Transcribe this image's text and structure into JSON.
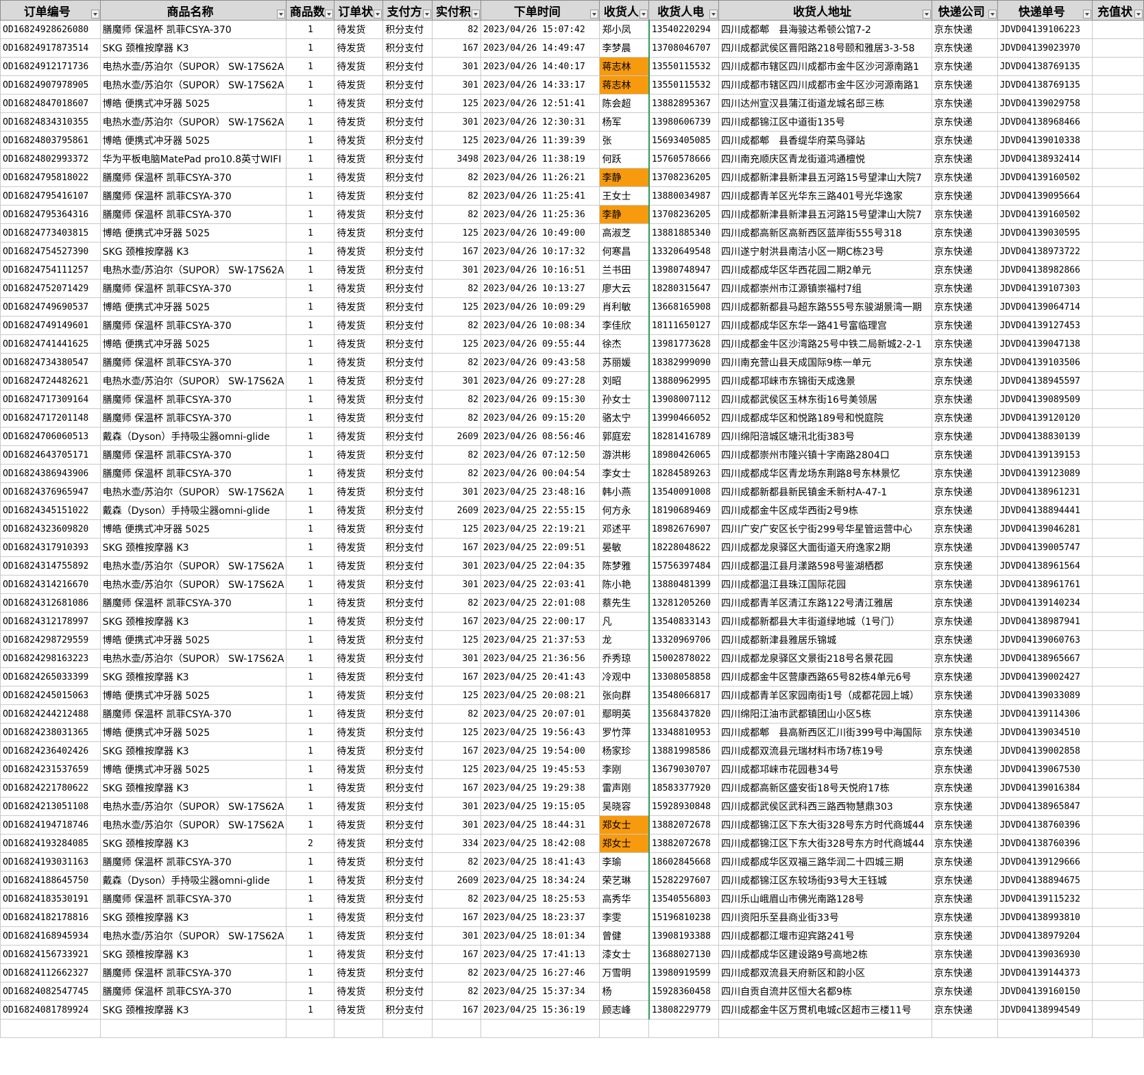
{
  "headers": [
    "订单编号",
    "商品名称",
    "商品数",
    "订单状",
    "支付方",
    "实付积",
    "下单时间",
    "收货人",
    "收货人电",
    "收货人地址",
    "快递公司",
    "快递单号",
    "充值状"
  ],
  "highlight_color": "#f79a0e",
  "rows": [
    [
      "OD16824928626080",
      "膳魔师 保温杯 凯菲CSYA-370",
      "1",
      "待发货",
      "积分支付",
      "82",
      "2023/04/26 15:07:42",
      "郑小凤",
      "13540220294",
      "四川成都郫　县海骏达希顿公馆7-2",
      "京东快递",
      "JDVD04139106223",
      "",
      false
    ],
    [
      "OD16824917873514",
      "SKG 颈椎按摩器 K3",
      "1",
      "待发货",
      "积分支付",
      "167",
      "2023/04/26 14:49:47",
      "李梦晨",
      "13708046707",
      "四川成都武侯区晋阳路218号颐和雅居3-3-58",
      "京东快递",
      "JDVD04139023970",
      "",
      false
    ],
    [
      "OD16824912171736",
      "电热水壶/苏泊尔（SUPOR） SW-17S62A",
      "1",
      "待发货",
      "积分支付",
      "301",
      "2023/04/26 14:40:17",
      "蒋志林",
      "13550115532",
      "四川成都市辖区四川成都市金牛区沙河源南路1",
      "京东快递",
      "JDVD04138769135",
      "",
      true
    ],
    [
      "OD16824907978905",
      "电热水壶/苏泊尔（SUPOR） SW-17S62A",
      "1",
      "待发货",
      "积分支付",
      "301",
      "2023/04/26 14:33:17",
      "蒋志林",
      "13550115532",
      "四川成都市辖区四川成都市金牛区沙河源南路1",
      "京东快递",
      "JDVD04138769135",
      "",
      true
    ],
    [
      "OD16824847018607",
      "博皓 便携式冲牙器 5025",
      "1",
      "待发货",
      "积分支付",
      "125",
      "2023/04/26 12:51:41",
      "陈会超",
      "13882895367",
      "四川达州宣汉县蒲江街道龙城名邸三栋",
      "京东快递",
      "JDVD04139029758",
      "",
      false
    ],
    [
      "OD16824834310355",
      "电热水壶/苏泊尔（SUPOR） SW-17S62A",
      "1",
      "待发货",
      "积分支付",
      "301",
      "2023/04/26 12:30:31",
      "杨军",
      "13980606739",
      "四川成都锦江区中道街135号",
      "京东快递",
      "JDVD04138968466",
      "",
      false
    ],
    [
      "OD16824803795861",
      "博皓 便携式冲牙器 5025",
      "1",
      "待发货",
      "积分支付",
      "125",
      "2023/04/26 11:39:39",
      "张",
      "15693405085",
      "四川成都郫　县香缇华府菜鸟驿站",
      "京东快递",
      "JDVD04139010338",
      "",
      false
    ],
    [
      "OD16824802993372",
      "华为平板电脑MatePad pro10.8英寸WIFI",
      "1",
      "待发货",
      "积分支付",
      "3498",
      "2023/04/26 11:38:19",
      "何跃",
      "15760578666",
      "四川南充顺庆区青龙街道鸿通檀悦",
      "京东快递",
      "JDVD04138932414",
      "",
      false
    ],
    [
      "OD16824795818022",
      "膳魔师 保温杯 凯菲CSYA-370",
      "1",
      "待发货",
      "积分支付",
      "82",
      "2023/04/26 11:26:21",
      "李静",
      "13708236205",
      "四川成都新津县新津县五河路15号望津山大院7",
      "京东快递",
      "JDVD04139160502",
      "",
      true
    ],
    [
      "OD16824795416107",
      "膳魔师 保温杯 凯菲CSYA-370",
      "1",
      "待发货",
      "积分支付",
      "82",
      "2023/04/26 11:25:41",
      "王女士",
      "13880034987",
      "四川成都青羊区光华东三路401号光华逸家",
      "京东快递",
      "JDVD04139095664",
      "",
      false
    ],
    [
      "OD16824795364316",
      "膳魔师 保温杯 凯菲CSYA-370",
      "1",
      "待发货",
      "积分支付",
      "82",
      "2023/04/26 11:25:36",
      "李静",
      "13708236205",
      "四川成都新津县新津县五河路15号望津山大院7",
      "京东快递",
      "JDVD04139160502",
      "",
      true
    ],
    [
      "OD16824773403815",
      "博皓 便携式冲牙器 5025",
      "1",
      "待发货",
      "积分支付",
      "125",
      "2023/04/26 10:49:00",
      "高淑芝",
      "13881885340",
      "四川成都高新区高新西区蓝岸街555号318",
      "京东快递",
      "JDVD04139030595",
      "",
      false
    ],
    [
      "OD16824754527390",
      "SKG 颈椎按摩器 K3",
      "1",
      "待发货",
      "积分支付",
      "167",
      "2023/04/26 10:17:32",
      "何寒昌",
      "13320649548",
      "四川遂宁射洪县南洁小区一期C栋23号",
      "京东快递",
      "JDVD04138973722",
      "",
      false
    ],
    [
      "OD16824754111257",
      "电热水壶/苏泊尔（SUPOR） SW-17S62A",
      "1",
      "待发货",
      "积分支付",
      "301",
      "2023/04/26 10:16:51",
      "兰书田",
      "13980748947",
      "四川成都成华区华西花园二期2单元",
      "京东快递",
      "JDVD04138982866",
      "",
      false
    ],
    [
      "OD16824752071429",
      "膳魔师 保温杯 凯菲CSYA-370",
      "1",
      "待发货",
      "积分支付",
      "82",
      "2023/04/26 10:13:27",
      "廖大云",
      "18280315647",
      "四川成都崇州市江源镇崇福村7组",
      "京东快递",
      "JDVD04139107303",
      "",
      false
    ],
    [
      "OD16824749690537",
      "博皓 便携式冲牙器 5025",
      "1",
      "待发货",
      "积分支付",
      "125",
      "2023/04/26 10:09:29",
      "肖利敏",
      "13668165908",
      "四川成都新都县马超东路555号东骏湖景湾一期",
      "京东快递",
      "JDVD04139064714",
      "",
      false
    ],
    [
      "OD16824749149601",
      "膳魔师 保温杯 凯菲CSYA-370",
      "1",
      "待发货",
      "积分支付",
      "82",
      "2023/04/26 10:08:34",
      "李佳欣",
      "18111650127",
      "四川成都成华区东华一路41号富临理宫",
      "京东快递",
      "JDVD04139127453",
      "",
      false
    ],
    [
      "OD16824741441625",
      "博皓 便携式冲牙器 5025",
      "1",
      "待发货",
      "积分支付",
      "125",
      "2023/04/26 09:55:44",
      "徐杰",
      "13981773628",
      "四川成都金牛区沙湾路25号中铁二局新城2-2-1",
      "京东快递",
      "JDVD04139047138",
      "",
      false
    ],
    [
      "OD16824734380547",
      "膳魔师 保温杯 凯菲CSYA-370",
      "1",
      "待发货",
      "积分支付",
      "82",
      "2023/04/26 09:43:58",
      "苏丽媛",
      "18382999090",
      "四川南充营山县天成国际9栋一单元",
      "京东快递",
      "JDVD04139103506",
      "",
      false
    ],
    [
      "OD16824724482621",
      "电热水壶/苏泊尔（SUPOR） SW-17S62A",
      "1",
      "待发货",
      "积分支付",
      "301",
      "2023/04/26 09:27:28",
      "刘昭",
      "13880962995",
      "四川成都邛崃市东锦街天成逸景",
      "京东快递",
      "JDVD04138945597",
      "",
      false
    ],
    [
      "OD16824717309164",
      "膳魔师 保温杯 凯菲CSYA-370",
      "1",
      "待发货",
      "积分支付",
      "82",
      "2023/04/26 09:15:30",
      "孙女士",
      "13908007112",
      "四川成都武侯区玉林东街16号美领居",
      "京东快递",
      "JDVD04139089509",
      "",
      false
    ],
    [
      "OD16824717201148",
      "膳魔师 保温杯 凯菲CSYA-370",
      "1",
      "待发货",
      "积分支付",
      "82",
      "2023/04/26 09:15:20",
      "骆太宁",
      "13990466052",
      "四川成都成华区和悦路189号和悦庭院",
      "京东快递",
      "JDVD04139120120",
      "",
      false
    ],
    [
      "OD16824706060513",
      "戴森（Dyson）手持吸尘器omni-glide",
      "1",
      "待发货",
      "积分支付",
      "2609",
      "2023/04/26 08:56:46",
      "郭庭宏",
      "18281416789",
      "四川绵阳涪城区塘汛北街383号",
      "京东快递",
      "JDVD04138830139",
      "",
      false
    ],
    [
      "OD16824643705171",
      "膳魔师 保温杯 凯菲CSYA-370",
      "1",
      "待发货",
      "积分支付",
      "82",
      "2023/04/26 07:12:50",
      "游洪彬",
      "18980426065",
      "四川成都崇州市隆兴镇十字南路2804口",
      "京东快递",
      "JDVD04139139153",
      "",
      false
    ],
    [
      "OD16824386943906",
      "膳魔师 保温杯 凯菲CSYA-370",
      "1",
      "待发货",
      "积分支付",
      "82",
      "2023/04/26 00:04:54",
      "李女士",
      "18284589263",
      "四川成都成华区青龙场东荆路8号东林景忆",
      "京东快递",
      "JDVD04139123089",
      "",
      false
    ],
    [
      "OD16824376965947",
      "电热水壶/苏泊尔（SUPOR） SW-17S62A",
      "1",
      "待发货",
      "积分支付",
      "301",
      "2023/04/25 23:48:16",
      "韩小燕",
      "13540091008",
      "四川成都新都县新民镇金禾新村A-47-1",
      "京东快递",
      "JDVD04138961231",
      "",
      false
    ],
    [
      "OD16824345151022",
      "戴森（Dyson）手持吸尘器omni-glide",
      "1",
      "待发货",
      "积分支付",
      "2609",
      "2023/04/25 22:55:15",
      "何方永",
      "18190689469",
      "四川成都金牛区成华西街2号9栋",
      "京东快递",
      "JDVD04138894441",
      "",
      false
    ],
    [
      "OD16824323609820",
      "博皓 便携式冲牙器 5025",
      "1",
      "待发货",
      "积分支付",
      "125",
      "2023/04/25 22:19:21",
      "邓述平",
      "18982676907",
      "四川广安广安区长宁街299号华星管运营中心",
      "京东快递",
      "JDVD04139046281",
      "",
      false
    ],
    [
      "OD16824317910393",
      "SKG 颈椎按摩器 K3",
      "1",
      "待发货",
      "积分支付",
      "167",
      "2023/04/25 22:09:51",
      "晏敏",
      "18228048622",
      "四川成都龙泉驿区大面街道天府逸家2期",
      "京东快递",
      "JDVD04139005747",
      "",
      false
    ],
    [
      "OD16824314755892",
      "电热水壶/苏泊尔（SUPOR） SW-17S62A",
      "1",
      "待发货",
      "积分支付",
      "301",
      "2023/04/25 22:04:35",
      "陈梦雅",
      "15756397484",
      "四川成都温江县月漾路598号鉴湖栖郡",
      "京东快递",
      "JDVD04138961564",
      "",
      false
    ],
    [
      "OD16824314216670",
      "电热水壶/苏泊尔（SUPOR） SW-17S62A",
      "1",
      "待发货",
      "积分支付",
      "301",
      "2023/04/25 22:03:41",
      "陈小艳",
      "13880481399",
      "四川成都温江县珠江国际花园",
      "京东快递",
      "JDVD04138961761",
      "",
      false
    ],
    [
      "OD16824312681086",
      "膳魔师 保温杯 凯菲CSYA-370",
      "1",
      "待发货",
      "积分支付",
      "82",
      "2023/04/25 22:01:08",
      "蔡先生",
      "13281205260",
      "四川成都青羊区清江东路122号清江雅居",
      "京东快递",
      "JDVD04139140234",
      "",
      false
    ],
    [
      "OD16824312178997",
      "SKG 颈椎按摩器 K3",
      "1",
      "待发货",
      "积分支付",
      "167",
      "2023/04/25 22:00:17",
      "凡",
      "13540833143",
      "四川成都新都县大丰街道绿地城（1号门）",
      "京东快递",
      "JDVD04138987941",
      "",
      false
    ],
    [
      "OD16824298729559",
      "博皓 便携式冲牙器 5025",
      "1",
      "待发货",
      "积分支付",
      "125",
      "2023/04/25 21:37:53",
      "龙",
      "13320969706",
      "四川成都新津县雅居乐锦城",
      "京东快递",
      "JDVD04139060763",
      "",
      false
    ],
    [
      "OD16824298163223",
      "电热水壶/苏泊尔（SUPOR） SW-17S62A",
      "1",
      "待发货",
      "积分支付",
      "301",
      "2023/04/25 21:36:56",
      "乔秀琼",
      "15002878022",
      "四川成都龙泉驿区文景街218号名景花园",
      "京东快递",
      "JDVD04138965667",
      "",
      false
    ],
    [
      "OD16824265033399",
      "SKG 颈椎按摩器 K3",
      "1",
      "待发货",
      "积分支付",
      "167",
      "2023/04/25 20:41:43",
      "冷观中",
      "13308058858",
      "四川成都金牛区营康西路65号82栋4单元6号",
      "京东快递",
      "JDVD04139002427",
      "",
      false
    ],
    [
      "OD16824245015063",
      "博皓 便携式冲牙器 5025",
      "1",
      "待发货",
      "积分支付",
      "125",
      "2023/04/25 20:08:21",
      "张向群",
      "13548066817",
      "四川成都青羊区家园南街1号（成都花园上城）",
      "京东快递",
      "JDVD04139033089",
      "",
      false
    ],
    [
      "OD16824244212488",
      "膳魔师 保温杯 凯菲CSYA-370",
      "1",
      "待发货",
      "积分支付",
      "82",
      "2023/04/25 20:07:01",
      "鄢明英",
      "13568437820",
      "四川绵阳江油市武都镇团山小区5栋",
      "京东快递",
      "JDVD04139114306",
      "",
      false
    ],
    [
      "OD16824238031365",
      "博皓 便携式冲牙器 5025",
      "1",
      "待发货",
      "积分支付",
      "125",
      "2023/04/25 19:56:43",
      "罗竹萍",
      "13348810953",
      "四川成都郫　县高新西区汇川街399号中海国际",
      "京东快递",
      "JDVD04139034510",
      "",
      false
    ],
    [
      "OD16824236402426",
      "SKG 颈椎按摩器 K3",
      "1",
      "待发货",
      "积分支付",
      "167",
      "2023/04/25 19:54:00",
      "杨家珍",
      "13881998586",
      "四川成都双流县元瑞材料市场7栋19号",
      "京东快递",
      "JDVD04139002858",
      "",
      false
    ],
    [
      "OD16824231537659",
      "博皓 便携式冲牙器 5025",
      "1",
      "待发货",
      "积分支付",
      "125",
      "2023/04/25 19:45:53",
      "李刚",
      "13679030707",
      "四川成都邛崃市花园巷34号",
      "京东快递",
      "JDVD04139067530",
      "",
      false
    ],
    [
      "OD16824221780622",
      "SKG 颈椎按摩器 K3",
      "1",
      "待发货",
      "积分支付",
      "167",
      "2023/04/25 19:29:38",
      "雷声刚",
      "18583377920",
      "四川成都高新区盛安街18号天悦府17栋",
      "京东快递",
      "JDVD04139016384",
      "",
      false
    ],
    [
      "OD16824213051108",
      "电热水壶/苏泊尔（SUPOR） SW-17S62A",
      "1",
      "待发货",
      "积分支付",
      "301",
      "2023/04/25 19:15:05",
      "吴晓容",
      "15928930848",
      "四川成都武侯区武科西三路西物慧鼎303",
      "京东快递",
      "JDVD04138965847",
      "",
      false
    ],
    [
      "OD16824194718746",
      "电热水壶/苏泊尔（SUPOR） SW-17S62A",
      "1",
      "待发货",
      "积分支付",
      "301",
      "2023/04/25 18:44:31",
      "郑女士",
      "13882072678",
      "四川成都锦江区下东大街328号东方时代商城44",
      "京东快递",
      "JDVD04138760396",
      "",
      true
    ],
    [
      "OD16824193284085",
      "SKG 颈椎按摩器 K3",
      "2",
      "待发货",
      "积分支付",
      "334",
      "2023/04/25 18:42:08",
      "郑女士",
      "13882072678",
      "四川成都锦江区下东大街328号东方时代商城44",
      "京东快递",
      "JDVD04138760396",
      "",
      true
    ],
    [
      "OD16824193031163",
      "膳魔师 保温杯 凯菲CSYA-370",
      "1",
      "待发货",
      "积分支付",
      "82",
      "2023/04/25 18:41:43",
      "李瑜",
      "18602845668",
      "四川成都成华区双福三路华润二十四城三期",
      "京东快递",
      "JDVD04139129666",
      "",
      false
    ],
    [
      "OD16824188645750",
      "戴森（Dyson）手持吸尘器omni-glide",
      "1",
      "待发货",
      "积分支付",
      "2609",
      "2023/04/25 18:34:24",
      "荣艺琳",
      "15282297607",
      "四川成都锦江区东较场街93号大王钰城",
      "京东快递",
      "JDVD04138894675",
      "",
      false
    ],
    [
      "OD16824183530191",
      "膳魔师 保温杯 凯菲CSYA-370",
      "1",
      "待发货",
      "积分支付",
      "82",
      "2023/04/25 18:25:53",
      "高秀华",
      "13540556803",
      "四川乐山峨眉山市佛光南路128号",
      "京东快递",
      "JDVD04139115232",
      "",
      false
    ],
    [
      "OD16824182178816",
      "SKG 颈椎按摩器 K3",
      "1",
      "待发货",
      "积分支付",
      "167",
      "2023/04/25 18:23:37",
      "李雯",
      "15196810238",
      "四川资阳乐至县商业街33号",
      "京东快递",
      "JDVD04138993810",
      "",
      false
    ],
    [
      "OD16824168945934",
      "电热水壶/苏泊尔（SUPOR） SW-17S62A",
      "1",
      "待发货",
      "积分支付",
      "301",
      "2023/04/25 18:01:34",
      "曾健",
      "13908193388",
      "四川成都都江堰市迎宾路241号",
      "京东快递",
      "JDVD04138979204",
      "",
      false
    ],
    [
      "OD16824156733921",
      "SKG 颈椎按摩器 K3",
      "1",
      "待发货",
      "积分支付",
      "167",
      "2023/04/25 17:41:13",
      "漆女士",
      "13688027130",
      "四川成都成华区建设路9号高地2栋",
      "京东快递",
      "JDVD04139036930",
      "",
      false
    ],
    [
      "OD16824112662327",
      "膳魔师 保温杯 凯菲CSYA-370",
      "1",
      "待发货",
      "积分支付",
      "82",
      "2023/04/25 16:27:46",
      "万雪明",
      "13980919599",
      "四川成都双流县天府新区和韵小区",
      "京东快递",
      "JDVD04139144373",
      "",
      false
    ],
    [
      "OD16824082547745",
      "膳魔师 保温杯 凯菲CSYA-370",
      "1",
      "待发货",
      "积分支付",
      "82",
      "2023/04/25 15:37:34",
      "杨",
      "15928360458",
      "四川自贡自流井区恒大名都9栋",
      "京东快递",
      "JDVD04139160150",
      "",
      false
    ],
    [
      "OD16824081789924",
      "SKG 颈椎按摩器 K3",
      "1",
      "待发货",
      "积分支付",
      "167",
      "2023/04/25 15:36:19",
      "顾志峰",
      "13808229779",
      "四川成都金牛区万贯机电城c区超市三楼11号",
      "京东快递",
      "JDVD04138994549",
      "",
      false
    ],
    [
      "",
      "",
      "",
      "",
      "",
      "",
      "",
      "",
      "",
      "",
      "",
      "",
      "",
      false
    ]
  ]
}
